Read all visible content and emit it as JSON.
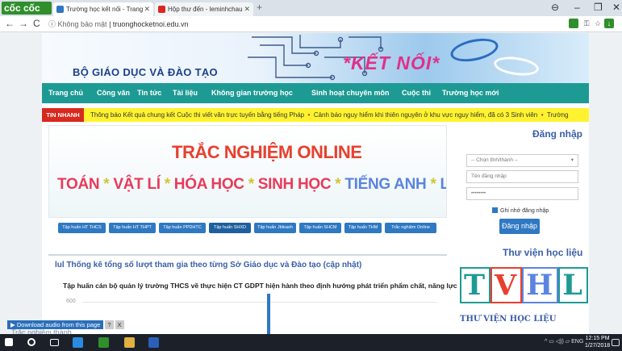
{
  "browser": {
    "app_name": "cốc cốc",
    "tabs": [
      {
        "title": "Trường học kết nối - Trang",
        "fav_color": "#2f78c2"
      },
      {
        "title": "Hộp thư đến - leminhchau",
        "fav_color": "#d8291f"
      }
    ],
    "new_tab": "+",
    "window_controls": {
      "account": "⊖",
      "minimize": "–",
      "maximize": "❐",
      "close": "✕"
    },
    "nav": {
      "back": "←",
      "forward": "→",
      "reload": "C"
    },
    "address": {
      "security": "ⓘ Không bảo mật",
      "url": "truonghocketnoi.edu.vn"
    }
  },
  "site": {
    "banner": {
      "ministry": "BỘ GIÁO DỤC VÀ ĐÀO TẠO",
      "slogan": "*KẾT NỐI*"
    },
    "menu": [
      "Trang chủ",
      "Công văn",
      "Tin tức",
      "Tài liệu",
      "Không gian trường học",
      "Sinh hoạt chuyên môn",
      "Cuộc thi",
      "Trường học mới"
    ],
    "ticker": {
      "label": "TIN NHANH",
      "items": [
        "Thông báo Kết quả chung kết Cuộc thi viết văn trực tuyến bằng tiếng Pháp",
        "Cảnh báo nguy hiểm khi thiên nguyên ở khu vực nguy hiểm, đã có 3 Sinh viên",
        "Trường"
      ]
    },
    "quiz_banner": {
      "title": "TRẮC NGHIỆM ONLINE",
      "subjects": [
        "TOÁN",
        "VẬT LÍ",
        "HÓA HỌC",
        "SINH HỌC",
        "TIẾNG ANH",
        "LỊCH SỬ"
      ]
    },
    "training_buttons": [
      "Tập huấn HT THCS",
      "Tập huấn HT THPT",
      "Tập huấn PPDHTC",
      "Tập huấn SHXD",
      "Tập huấn Jbleash",
      "Tập huấn SHCM",
      "Tập huấn THM",
      "Trắc nghiệm Online"
    ],
    "stats": {
      "icon": "lul",
      "title": "Thống kê tổng số lượt tham gia theo từng Sở Giáo dục và Đào tạo (cập nhật)",
      "subtitle": "Tập huấn cán bộ quản lý trường THCS về thực hiện CT GDPT hiện hành theo định hướng phát triển phẩm chất, năng lực HS",
      "y_tick": "600"
    },
    "login": {
      "title": "Đăng nhập",
      "province_placeholder": "-- Chọn tỉnh/thành --",
      "username_placeholder": "Tên đăng nhập",
      "password_value": "••••••••",
      "remember_label": "Ghi nhớ đăng nhập",
      "button_label": "Đăng nhập"
    },
    "library": {
      "title": "Thư viện học liệu",
      "letters": [
        "T",
        "V",
        "H",
        "L"
      ],
      "caption": "THƯ VIỆN HỌC LIỆU"
    },
    "audio_bar": {
      "label": "▶ Download audio from this page",
      "help": "?",
      "close": "X"
    },
    "ghost_text": "Trắc nghiệm thành"
  },
  "chart_data": {
    "type": "bar",
    "title": "Tập huấn cán bộ quản lý trường THCS về thực hiện CT GDPT hiện hành theo định hướng phát triển phẩm chất, năng lực HS",
    "y_ticks": [
      600
    ],
    "categories": [
      ""
    ],
    "values": [
      700
    ],
    "ylim": [
      0,
      700
    ],
    "bar_color": "#2f78c2",
    "grid": true
  },
  "taskbar": {
    "tray_text": "^ ▭ ◁)) ▱ ENG",
    "time": "12:15 PM",
    "date": "1/27/2018"
  }
}
